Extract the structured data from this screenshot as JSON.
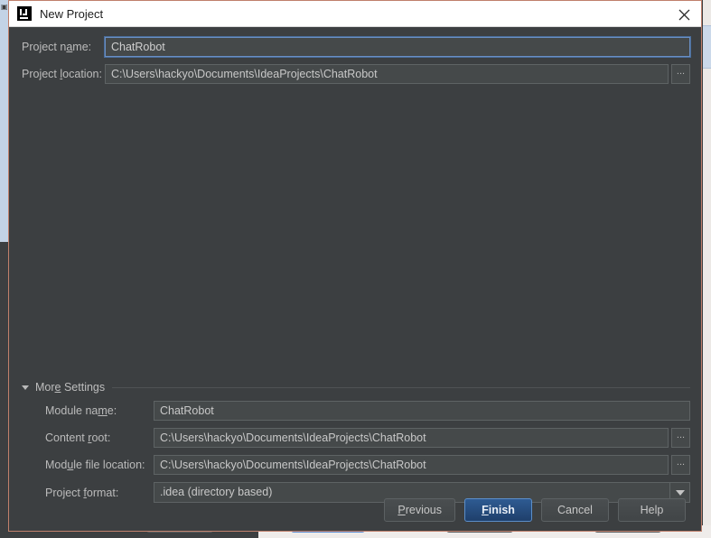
{
  "window": {
    "title": "New Project",
    "app_icon": "intellij-idea-icon",
    "close_icon": "close-icon",
    "border_color": "#c0806c",
    "titlebar_bg": "#ffffff",
    "body_bg": "#3c3f41"
  },
  "form": {
    "project_name": {
      "label_pre": "Project n",
      "label_mnemonic": "a",
      "label_post": "me:",
      "value": "ChatRobot",
      "focused": true
    },
    "project_location": {
      "label_pre": "Project ",
      "label_mnemonic": "l",
      "label_post": "ocation:",
      "value": "C:\\Users\\hackyo\\Documents\\IdeaProjects\\ChatRobot",
      "browse_label": "..."
    }
  },
  "more_settings": {
    "label_pre": "Mor",
    "label_mnemonic": "e",
    "label_post": " Settings",
    "expanded": true,
    "toggle_icon": "chevron-down-icon",
    "rows": [
      {
        "name": "module-name",
        "label_pre": "Module na",
        "label_mnemonic": "m",
        "label_post": "e:",
        "value": "ChatRobot",
        "has_browse": false,
        "type": "text"
      },
      {
        "name": "content-root",
        "label_pre": "Content ",
        "label_mnemonic": "r",
        "label_post": "oot:",
        "value": "C:\\Users\\hackyo\\Documents\\IdeaProjects\\ChatRobot",
        "has_browse": true,
        "browse_label": "...",
        "type": "text"
      },
      {
        "name": "module-file-location",
        "label_pre": "Mod",
        "label_mnemonic": "u",
        "label_post": "le file location:",
        "value": "C:\\Users\\hackyo\\Documents\\IdeaProjects\\ChatRobot",
        "has_browse": true,
        "browse_label": "...",
        "type": "text"
      },
      {
        "name": "project-format",
        "label_pre": "Project ",
        "label_mnemonic": "f",
        "label_post": "ormat:",
        "value": ".idea (directory based)",
        "has_browse": false,
        "type": "combo",
        "dropdown_icon": "chevron-down-icon"
      }
    ]
  },
  "footer": {
    "buttons": [
      {
        "name": "previous",
        "pre": "",
        "mnemonic": "P",
        "post": "revious",
        "primary": false
      },
      {
        "name": "finish",
        "pre": "",
        "mnemonic": "F",
        "post": "inish",
        "primary": true
      },
      {
        "name": "cancel",
        "pre": "Cancel",
        "mnemonic": "",
        "post": "",
        "primary": false
      },
      {
        "name": "help",
        "pre": "Help",
        "mnemonic": "",
        "post": "",
        "primary": false
      }
    ]
  }
}
